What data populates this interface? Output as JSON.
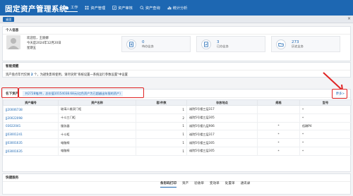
{
  "app": {
    "title": "固定资产管理系统"
  },
  "nav": {
    "items": [
      {
        "label": "工作",
        "active": true
      },
      {
        "label": "资产管理"
      },
      {
        "label": "资产审核"
      },
      {
        "label": "资产查询"
      },
      {
        "label": "统计分析"
      }
    ]
  },
  "tabstrip": {
    "home_tab": "桌面"
  },
  "info": {
    "title": "个人信息",
    "greeting": "欢迎您，王丽娜",
    "date": "今天是2024年12月20日",
    "weekday": "星期五",
    "cards": [
      {
        "value": "0",
        "label": "待办业务"
      },
      {
        "value": "3",
        "label": "已办业务"
      },
      {
        "value": "273",
        "label": "历史业务"
      }
    ]
  },
  "reminder": {
    "title": "智能提醒",
    "prefix": "资产盘点年代仅剩",
    "days": "2",
    "suffix": "个，为避免影响使用，请尽快到\"系统设置一系统运行参数设置\"中设置"
  },
  "assets": {
    "label": "名下资产",
    "notice": "共2728笔/件，总价值10154038.68元(红色资产为已超越出年限的资产)",
    "more": "更多>",
    "columns": [
      "资产编号",
      "资产名称",
      "套/件数",
      "存放地点",
      "规格",
      "型号"
    ],
    "rows": [
      {
        "code": "JJ20006738",
        "name": "玻璃二维双门柜",
        "qty": "1",
        "place": "诚院5号楼三层317",
        "spec": "",
        "model": "*"
      },
      {
        "code": "JJ20022098",
        "name": "十斗三门柜",
        "qty": "2",
        "place": "诚院5号楼三层305",
        "spec": "",
        "model": "*"
      },
      {
        "code": "03022041",
        "name": "服务器",
        "qty": "1",
        "place": "诚院5号楼九层906",
        "spec": "*",
        "model": "低酬P4"
      },
      {
        "code": "JJ03001241",
        "name": "十斗柜",
        "qty": "1",
        "place": "诚院5号楼三层317",
        "spec": "*",
        "model": "*"
      },
      {
        "code": "JJ03001635",
        "name": "电脑椅",
        "qty": "1",
        "place": "诚院5号楼三层305",
        "spec": "*",
        "model": "*"
      },
      {
        "code": "JJ03001635",
        "name": "电脑椅",
        "qty": "1",
        "place": "诚院5号楼三层305",
        "spec": "*",
        "model": "*"
      }
    ]
  },
  "quick": {
    "title": "快捷服务",
    "tabs": [
      "条形码打印",
      "资产",
      "验收单",
      "变动单",
      "处置单",
      "通讯录"
    ]
  },
  "colors": {
    "primary": "#1d67b2",
    "annotation": "#e02424"
  }
}
